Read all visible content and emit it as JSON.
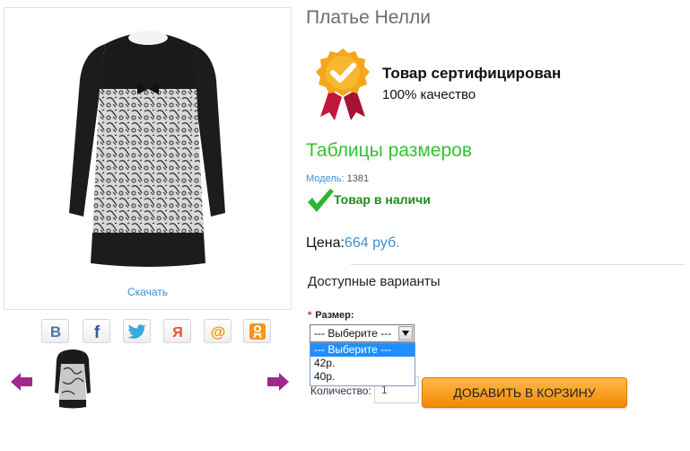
{
  "product": {
    "title": "Платье Нелли",
    "download_label": "Скачать"
  },
  "certificate": {
    "title": "Товар сертифицирован",
    "subtitle": "100% качество"
  },
  "size_tables_link": "Таблицы размеров",
  "model": {
    "label": "Модель:",
    "value": "1381"
  },
  "stock_status": "Товар в наличи",
  "price": {
    "label": "Цена:",
    "value": "664 руб."
  },
  "variants_heading": "Доступные варианты",
  "size": {
    "required_mark": "*",
    "label": "Размер:",
    "selected": "--- Выберите ---",
    "options": [
      "--- Выберите ---",
      "42р.",
      "40р."
    ]
  },
  "quantity": {
    "label": "Количество:",
    "value": "1"
  },
  "add_to_cart_label": "ДОБАВИТЬ В КОРЗИНУ",
  "social_icons": [
    "vk-icon",
    "facebook-icon",
    "twitter-icon",
    "moimir-icon",
    "mailru-icon",
    "odnoklassniki-icon"
  ],
  "colors": {
    "accent_blue": "#3b8fd1",
    "green_link": "#31c331",
    "stock_green": "#1f8a1f",
    "button_orange": "#f38a00",
    "arrow_purple": "#a0288c",
    "select_highlight": "#1e8fff"
  }
}
